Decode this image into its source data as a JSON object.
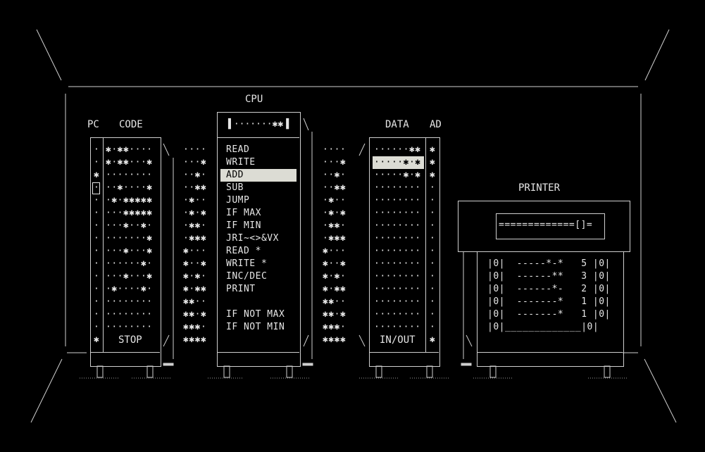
{
  "labels": {
    "cpu": "CPU",
    "pc": "PC",
    "code": "CODE",
    "data": "DATA",
    "ad": "AD",
    "printer": "PRINTER",
    "stop": "STOP",
    "inout": "IN/OUT"
  },
  "cpu_display": "·······✱✱",
  "pc_column": [
    "·",
    "·",
    "✱",
    "·",
    "·",
    "·",
    "·",
    "·",
    "·",
    "·",
    "·",
    "·",
    "·",
    "·",
    "·",
    "✱"
  ],
  "pc_current_index": 3,
  "code_rows": [
    "✱·✱✱····",
    "✱·✱✱···✱",
    "········",
    "··✱····✱",
    "·✱·✱✱✱✱✱",
    "···✱✱✱✱✱",
    "···✱··✱·",
    "·······✱",
    "···✱···✱",
    "······✱·",
    "···✱···✱",
    "·✱····✱·",
    "········",
    "········",
    "········"
  ],
  "opcode_left": [
    "····",
    "···✱",
    "··✱·",
    "··✱✱",
    "·✱··",
    "·✱·✱",
    "·✱✱·",
    "·✱✱✱",
    "✱···",
    "✱··✱",
    "✱·✱·",
    "✱·✱✱",
    "✱✱··",
    "✱✱·✱",
    "✱✱✱·",
    "✱✱✱✱"
  ],
  "opcode_right": [
    "····",
    "···✱",
    "··✱·",
    "··✱✱",
    "·✱··",
    "·✱·✱",
    "·✱✱·",
    "·✱✱✱",
    "✱···",
    "✱··✱",
    "✱·✱·",
    "✱·✱✱",
    "✱✱··",
    "✱✱·✱",
    "✱✱✱·",
    "✱✱✱✱"
  ],
  "instructions": [
    "READ",
    "WRITE",
    "ADD",
    "SUB",
    "JUMP",
    "IF MAX",
    "IF MIN",
    "JRI~<>&VX",
    "READ *",
    "WRITE *",
    "INC/DEC",
    "PRINT",
    "",
    "IF NOT MAX",
    "IF NOT MIN"
  ],
  "instruction_selected_index": 2,
  "data_rows": [
    "······✱✱",
    "·····✱·✱",
    "·····✱·✱",
    "········",
    "········",
    "········",
    "········",
    "········",
    "········",
    "········",
    "········",
    "········",
    "········",
    "········",
    "········"
  ],
  "data_selected_index": 1,
  "ad_column": [
    "✱",
    "✱",
    "✱",
    "·",
    "·",
    "·",
    "·",
    "·",
    "·",
    "·",
    "·",
    "·",
    "·",
    "·",
    "·",
    "✱"
  ],
  "printer_display": "=============[]=",
  "printer_lines": [
    "|0|  -----*-*   5 |0|",
    "|0|  ------**   3 |0|",
    "|0|  ------*-   2 |0|",
    "|0|  -------*   1 |0|",
    "|0|  -------*   1 |0|",
    "|0|_____________|0|"
  ],
  "colors": {
    "background": "#000000",
    "foreground": "#e6e6e6",
    "highlight": "#dcdcd4"
  }
}
